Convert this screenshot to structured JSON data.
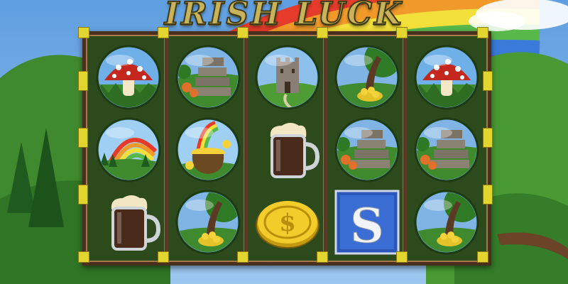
{
  "game": {
    "title": "IRISH LUCK"
  },
  "reels": [
    [
      "mushroom-icon",
      "rainbow-icon",
      "beer-mug-icon"
    ],
    [
      "stone-steps-icon",
      "pot-of-gold-icon",
      "tree-of-gold-icon"
    ],
    [
      "castle-icon",
      "beer-mug-icon",
      "gold-coin-icon"
    ],
    [
      "tree-of-gold-icon",
      "stone-steps-icon",
      "scatter-s-icon"
    ],
    [
      "mushroom-icon",
      "stone-steps-icon",
      "tree-of-gold-icon"
    ]
  ],
  "scatter_symbol": {
    "letter": "S"
  },
  "coin_symbol": {
    "glyph": "$"
  },
  "colors": {
    "sky": "#6fa8e0",
    "frame_wood": "#4a2f1e",
    "reel_bg": "#2d4a1d",
    "clip_yellow": "#e3d530",
    "title_gold": "#c9b35a"
  }
}
